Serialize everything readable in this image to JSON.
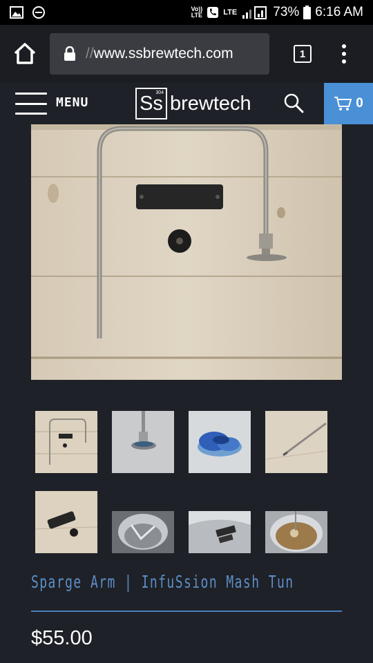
{
  "status_bar": {
    "volte_label": "Vo))",
    "lte_small": "LTE",
    "lte_signal_label": "LTE",
    "battery_percent": "73%",
    "time": "6:16 AM"
  },
  "browser": {
    "url_protocol": "//",
    "url_host": "www.ssbrewtech.com",
    "tab_count": "1"
  },
  "site_header": {
    "menu_label": "MENU",
    "logo_mark": "Ss",
    "logo_sup": "304",
    "logo_text": "brewtech",
    "cart_count": "0",
    "accent_color": "#4a90d6"
  },
  "product": {
    "title": "Sparge Arm | InfuSsion Mash Tun",
    "price": "$55.00",
    "title_color": "#5d8ec9"
  },
  "icons": [
    "gallery-icon",
    "minus-circle-icon",
    "phone-icon",
    "signal-icon",
    "battery-icon",
    "home-icon",
    "lock-icon",
    "tabs-icon",
    "kebab-menu-icon",
    "hamburger-icon",
    "search-icon",
    "cart-icon"
  ]
}
